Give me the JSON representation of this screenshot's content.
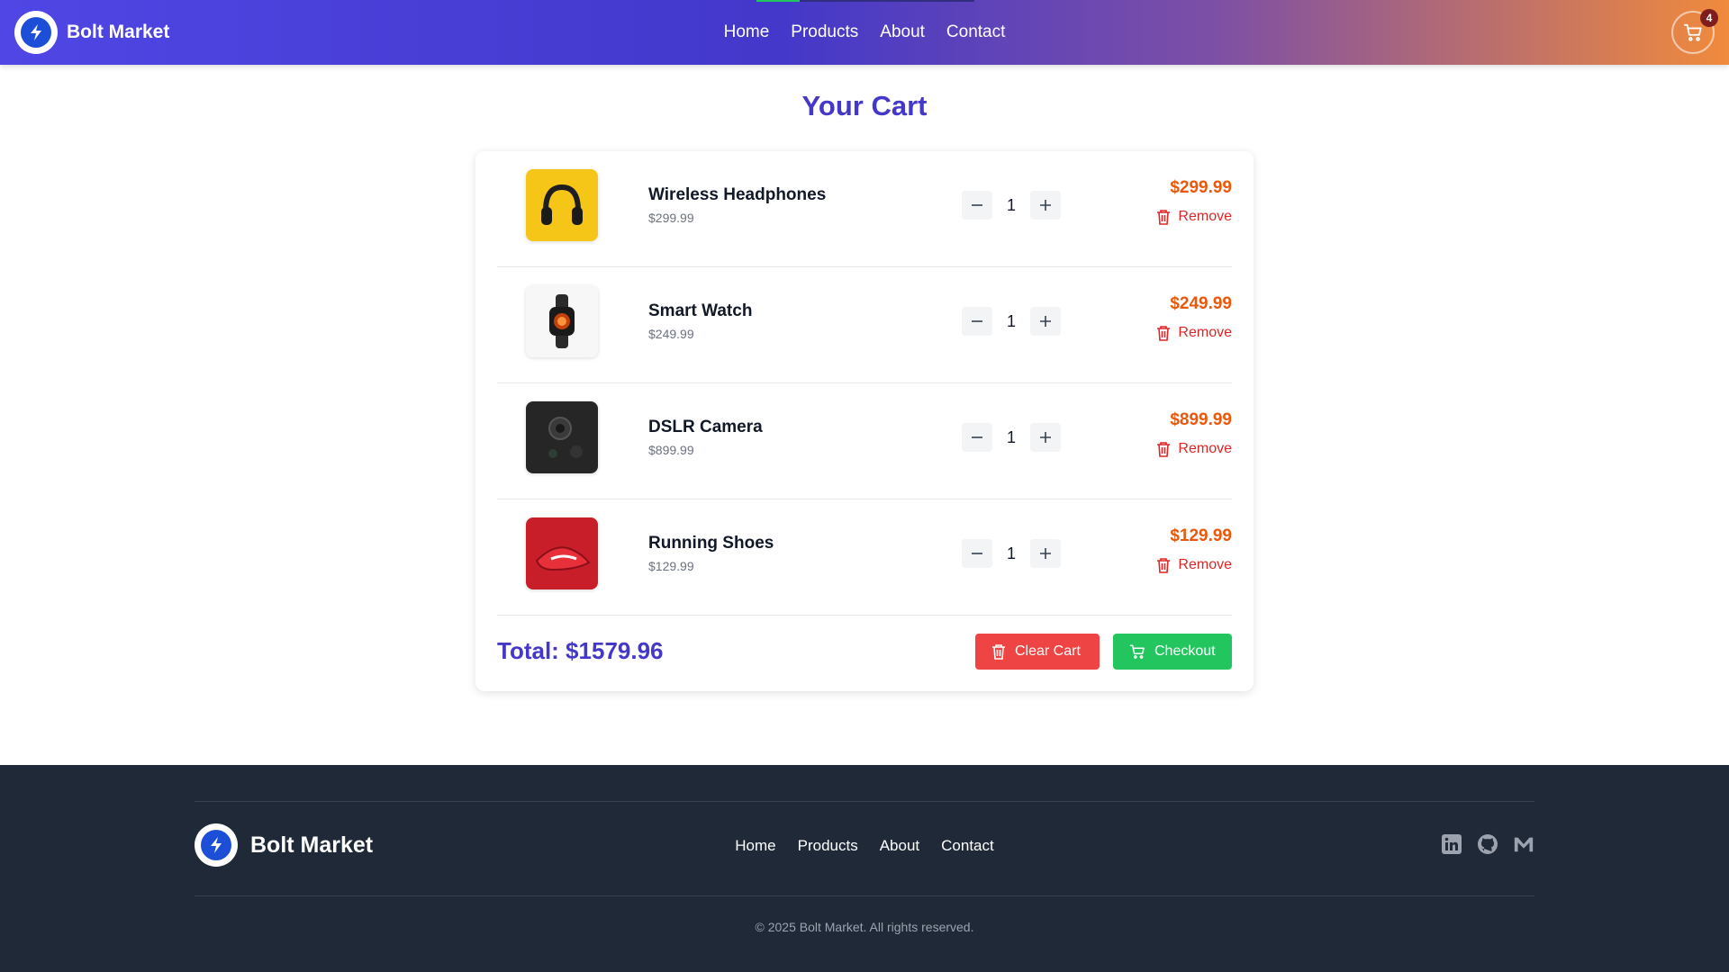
{
  "header": {
    "brand": "Bolt Market",
    "nav": [
      "Home",
      "Products",
      "About",
      "Contact"
    ],
    "cart_count": "4"
  },
  "page": {
    "title": "Your Cart"
  },
  "cart": {
    "items": [
      {
        "name": "Wireless Headphones",
        "unit_price": "$299.99",
        "quantity": "1",
        "line_price": "$299.99",
        "remove_label": "Remove"
      },
      {
        "name": "Smart Watch",
        "unit_price": "$249.99",
        "quantity": "1",
        "line_price": "$249.99",
        "remove_label": "Remove"
      },
      {
        "name": "DSLR Camera",
        "unit_price": "$899.99",
        "quantity": "1",
        "line_price": "$899.99",
        "remove_label": "Remove"
      },
      {
        "name": "Running Shoes",
        "unit_price": "$129.99",
        "quantity": "1",
        "line_price": "$129.99",
        "remove_label": "Remove"
      }
    ],
    "total_label": "Total: $1579.96",
    "clear_label": "Clear Cart",
    "checkout_label": "Checkout"
  },
  "footer": {
    "brand": "Bolt Market",
    "nav": [
      "Home",
      "Products",
      "About",
      "Contact"
    ],
    "social": [
      "linkedin-icon",
      "github-icon",
      "mail-icon"
    ],
    "copyright": "© 2025 Bolt Market. All rights reserved."
  },
  "colors": {
    "primary": "#4338ca",
    "price": "#ea580c",
    "danger": "#ef4444",
    "success": "#22c55e",
    "footer_bg": "#1f2937"
  }
}
